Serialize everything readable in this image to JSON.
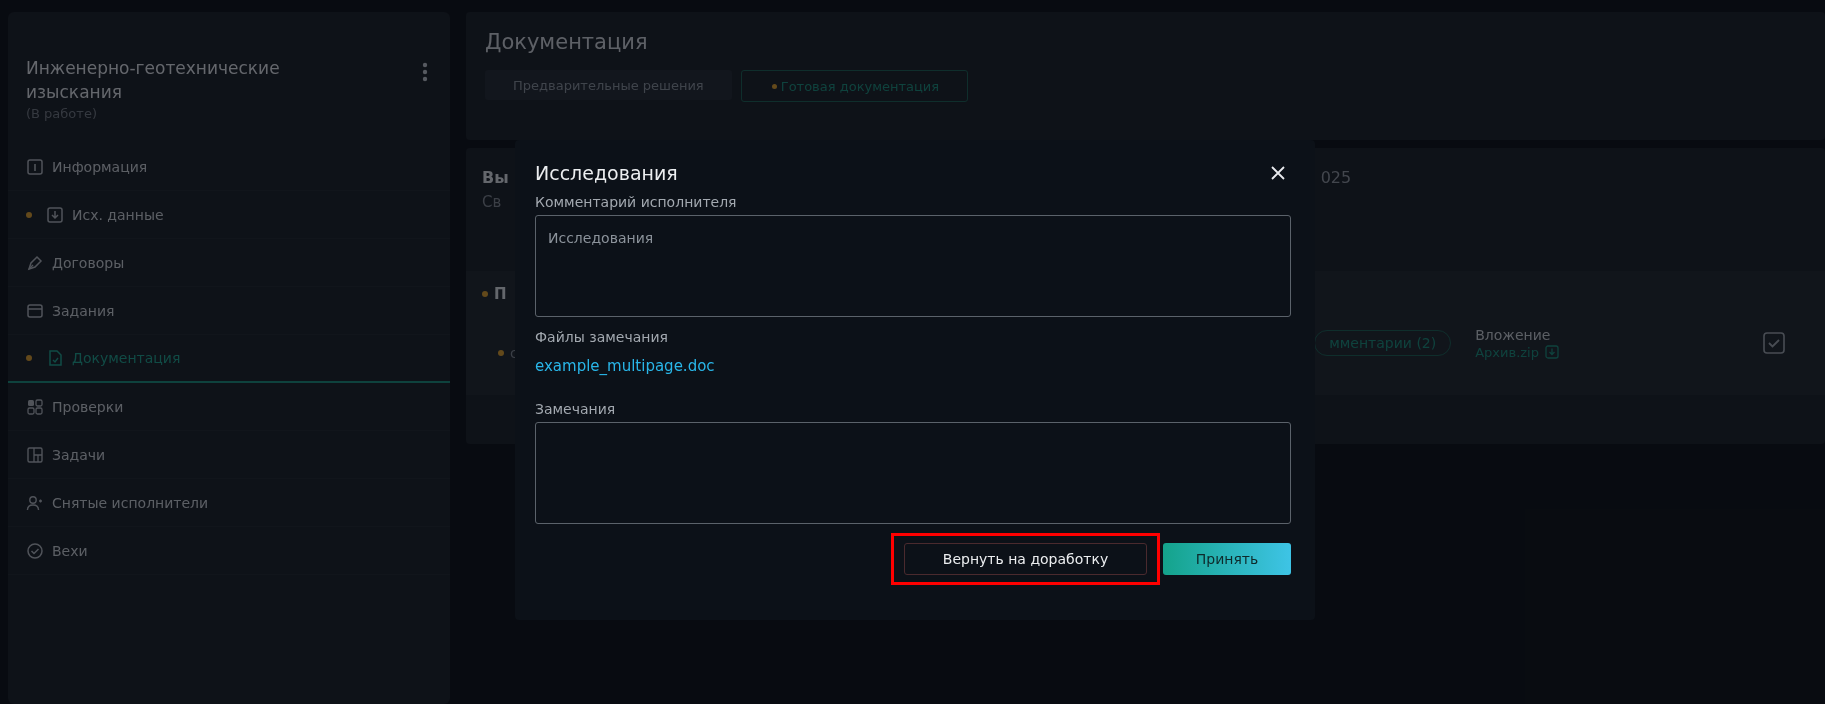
{
  "sidebar": {
    "title": "Инженерно-геотехнические изыскания",
    "status": "(В работе)",
    "items": [
      {
        "label": "Информация",
        "dot": false,
        "selected": false
      },
      {
        "label": "Исх. данные",
        "dot": true,
        "selected": false
      },
      {
        "label": "Договоры",
        "dot": false,
        "selected": false
      },
      {
        "label": "Задания",
        "dot": false,
        "selected": false
      },
      {
        "label": "Документация",
        "dot": true,
        "selected": true
      },
      {
        "label": "Проверки",
        "dot": false,
        "selected": false
      },
      {
        "label": "Задачи",
        "dot": false,
        "selected": false
      },
      {
        "label": "Снятые исполнители",
        "dot": false,
        "selected": false
      },
      {
        "label": "Вехи",
        "dot": false,
        "selected": false
      }
    ]
  },
  "main": {
    "title": "Документация",
    "tabs": [
      {
        "label": "Предварительные решения",
        "dot": false,
        "selected": false
      },
      {
        "label": "Готовая документация",
        "dot": true,
        "selected": true
      }
    ],
    "card": {
      "heading_part": "Вы",
      "subtitle_part": "Св",
      "date_part": "025"
    },
    "section": {
      "title_part": "П",
      "row": {
        "dot": true,
        "text_part": "с",
        "comments": "мментарии (2)",
        "attachment_label": "Вложение",
        "attachment_file": "Архив.zip",
        "checked": true
      }
    }
  },
  "dialog": {
    "title": "Исследования",
    "comment_label": "Комментарий исполнителя",
    "comment_value": "Исследования",
    "files_label": "Файлы замечания",
    "file": "example_multipage.doc",
    "remarks_label": "Замечания",
    "buttons": [
      {
        "label": "Вернуть на доработку",
        "kind": "secondary",
        "highlighted": true
      },
      {
        "label": "Принять",
        "kind": "primary",
        "highlighted": false
      }
    ]
  }
}
